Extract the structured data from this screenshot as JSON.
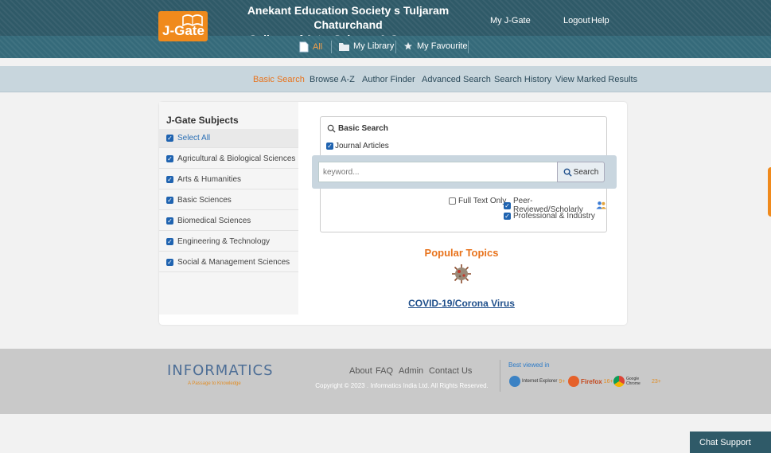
{
  "header": {
    "logo_text": "J-Gate",
    "college_line1": "Anekant Education Society s Tuljaram Chaturchand",
    "college_line2": "College of Arts, Science & Commerce",
    "links": {
      "my_jgate": "My J-Gate",
      "logout": "Logout",
      "help": "Help"
    }
  },
  "tabs": {
    "all": "All",
    "my_library": "My Library",
    "my_favourite": "My Favourite"
  },
  "nav": {
    "items": [
      "Basic Search",
      "Browse A-Z",
      "Author Finder",
      "Advanced Search",
      "Search History",
      "View Marked Results"
    ],
    "active_index": 0
  },
  "subjects": {
    "title": "J-Gate Subjects",
    "items": [
      "Select All",
      "Agricultural & Biological Sciences",
      "Arts & Humanities",
      "Basic Sciences",
      "Biomedical Sciences",
      "Engineering & Technology",
      "Social & Management Sciences"
    ]
  },
  "search": {
    "title": "Basic Search",
    "journal_label": "Journal Articles",
    "placeholder": "keyword...",
    "button": "Search",
    "full_text": "Full Text Only",
    "peer_reviewed": "Peer-Reviewed/Scholarly",
    "professional": "Professional & Industry"
  },
  "popular": {
    "title": "Popular Topics",
    "topic": "COVID-19/Corona Virus"
  },
  "footer": {
    "logo": "INFORMATICS",
    "tagline": "A Passage to Knowledge",
    "links": {
      "about": "About",
      "faq": "FAQ",
      "admin": "Admin",
      "contact": "Contact Us"
    },
    "copyright": "Copyright © 2023 . Informatics India Ltd. All Rights Reserved.",
    "best_viewed": "Best viewed in",
    "browsers": [
      {
        "name": "Internet Explorer",
        "version": "9+"
      },
      {
        "name": "Firefox",
        "version": "16+"
      },
      {
        "name": "Google Chrome",
        "version": "23+"
      }
    ]
  },
  "chat": {
    "label": "Chat Support"
  },
  "colors": {
    "header": "#2f5a68",
    "accent": "#f08a1c",
    "link": "#1f4f8b",
    "checkbox": "#1f63b0"
  }
}
